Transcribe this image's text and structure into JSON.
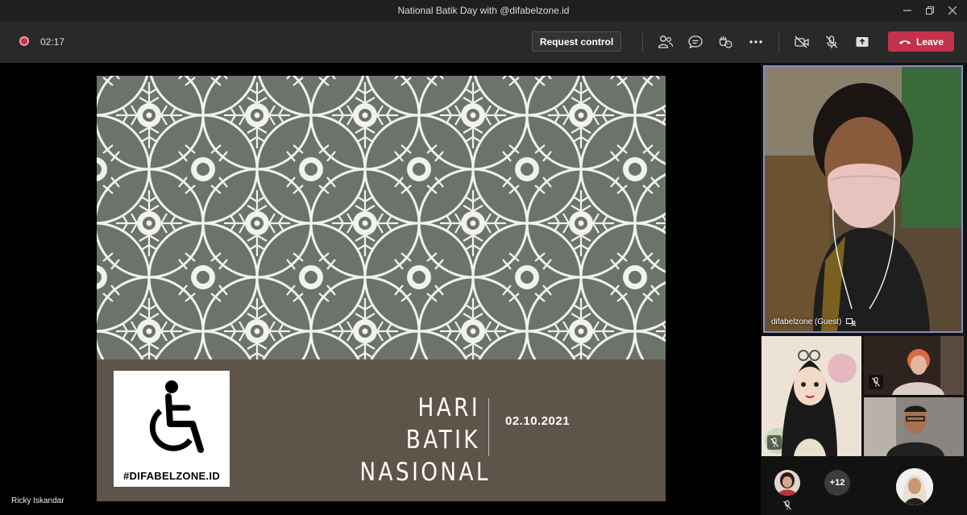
{
  "window": {
    "title": "National Batik Day with @difabelzone.id"
  },
  "toolbar": {
    "timer": "02:17",
    "request_control_label": "Request control",
    "leave_label": "Leave"
  },
  "slide": {
    "title_line1": "HARI BATIK",
    "title_line2": "NASIONAL",
    "date": "02.10.2021",
    "logo_text": "#DIFABELZONE.ID"
  },
  "presenter_name": "Ricky Iskandar",
  "participants": {
    "main_name": "difabelzone (Guest)",
    "more_count": "+12"
  },
  "colors": {
    "leave_red": "#c4314b",
    "active_border": "#8b8cc7",
    "batik_green": "#6b736b",
    "slide_brown": "#5f5449"
  }
}
